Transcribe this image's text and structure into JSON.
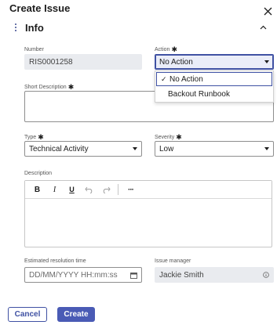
{
  "dialog": {
    "title": "Create Issue"
  },
  "section": {
    "title": "Info"
  },
  "fields": {
    "number": {
      "label": "Number",
      "value": "RIS0001258"
    },
    "action": {
      "label": "Action",
      "value": "No Action",
      "options": [
        {
          "label": "No Action",
          "selected": true
        },
        {
          "label": "Backout Runbook",
          "selected": false
        }
      ]
    },
    "short_description": {
      "label": "Short Description",
      "value": ""
    },
    "type": {
      "label": "Type",
      "value": "Technical Activity"
    },
    "severity": {
      "label": "Severity",
      "value": "Low"
    },
    "description": {
      "label": "Description",
      "value": ""
    },
    "estimated_resolution_time": {
      "label": "Estimated resolution time",
      "placeholder": "DD/MM/YYYY HH:mm:ss"
    },
    "issue_manager": {
      "label": "Issue manager",
      "value": "Jackie Smith"
    }
  },
  "required_marker": "✱",
  "editor_toolbar": {
    "bold": "B",
    "italic": "I",
    "underline": "U",
    "undo_icon": "undo-icon",
    "redo_icon": "redo-icon",
    "more": "···"
  },
  "footer": {
    "cancel_label": "Cancel",
    "create_label": "Create"
  },
  "colors": {
    "accent": "#3f51a3",
    "primary_button": "#4a5bb5",
    "readonly_bg": "#e9ebef"
  }
}
